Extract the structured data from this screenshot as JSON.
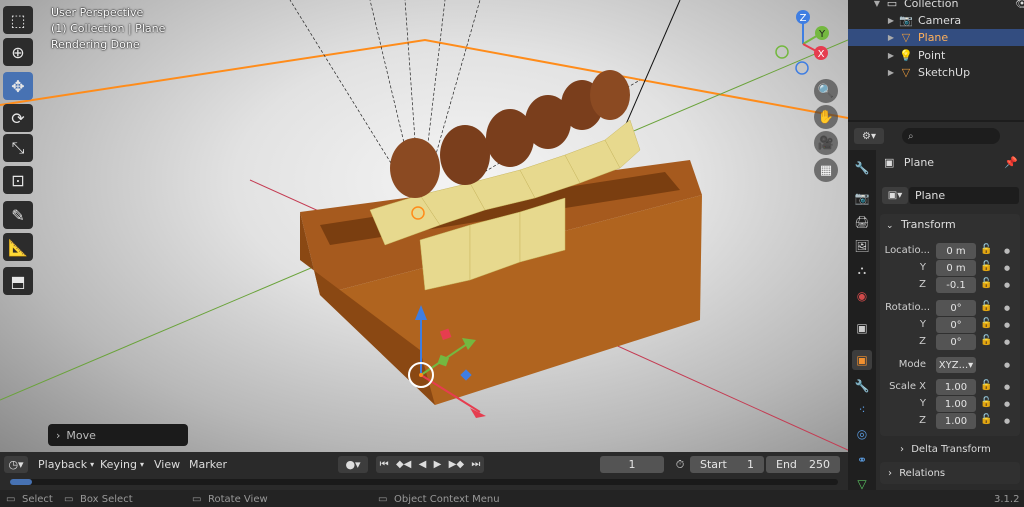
{
  "viewport": {
    "view_name": "User Perspective",
    "collection_object": "(1) Collection | Plane",
    "status": "Rendering Done",
    "last_operator": "Move",
    "gizmo_axes": {
      "z": "Z",
      "y": "Y",
      "x": "X"
    }
  },
  "toolbar": {
    "tools": [
      {
        "name": "select-box-tool",
        "glyph": "⬚"
      },
      {
        "name": "cursor-tool",
        "glyph": "⊕"
      },
      {
        "name": "move-tool",
        "glyph": "✥"
      },
      {
        "name": "rotate-tool",
        "glyph": "⟳"
      },
      {
        "name": "scale-tool",
        "glyph": "⤡"
      },
      {
        "name": "transform-tool",
        "glyph": "⊡"
      },
      {
        "name": "annotate-tool",
        "glyph": "✎"
      },
      {
        "name": "measure-tool",
        "glyph": "📐"
      },
      {
        "name": "add-cube-tool",
        "glyph": "⬒"
      }
    ],
    "active": "move-tool"
  },
  "outliner": {
    "collection_label": "Collection",
    "items": [
      {
        "label": "Camera",
        "icon": "camera-icon",
        "glyph": "📷",
        "selected": false
      },
      {
        "label": "Plane",
        "icon": "plane-mesh-icon",
        "glyph": "▽",
        "selected": true
      },
      {
        "label": "Point",
        "icon": "light-icon",
        "glyph": "💡",
        "selected": false
      },
      {
        "label": "SketchUp",
        "icon": "mesh-icon",
        "glyph": "▽",
        "selected": false
      }
    ]
  },
  "properties": {
    "search_placeholder": "",
    "object_name": "Plane",
    "data_name": "Plane",
    "transform_header": "Transform",
    "location_label": "Locatio...",
    "location": {
      "x": "0 m",
      "y": "0 m",
      "z": "-0.1"
    },
    "rotation_label": "Rotatio...",
    "rotation": {
      "x": "0°",
      "y": "0°",
      "z": "0°"
    },
    "mode_label": "Mode",
    "mode_value": "XYZ...",
    "scale_label": "Scale X",
    "scale": {
      "x": "1.00",
      "y": "1.00",
      "z": "1.00"
    },
    "axis_y": "Y",
    "axis_z": "Z",
    "delta_transform": "Delta Transform",
    "relations": "Relations"
  },
  "timeline": {
    "playback": "Playback",
    "keying": "Keying",
    "view": "View",
    "marker": "Marker",
    "current_frame": "1",
    "start_label": "Start",
    "start": "1",
    "end_label": "End",
    "end": "250"
  },
  "statusbar": {
    "select": "Select",
    "box_select": "Box Select",
    "rotate_view": "Rotate View",
    "object_context_menu": "Object Context Menu",
    "version": "3.1.2"
  },
  "colors": {
    "accent": "#4772b3",
    "selected_row": "#334d80",
    "axis_x": "#e63d4f",
    "axis_y": "#74b840",
    "axis_z": "#3f7ee2",
    "selection_outline": "#ff8c1a"
  }
}
